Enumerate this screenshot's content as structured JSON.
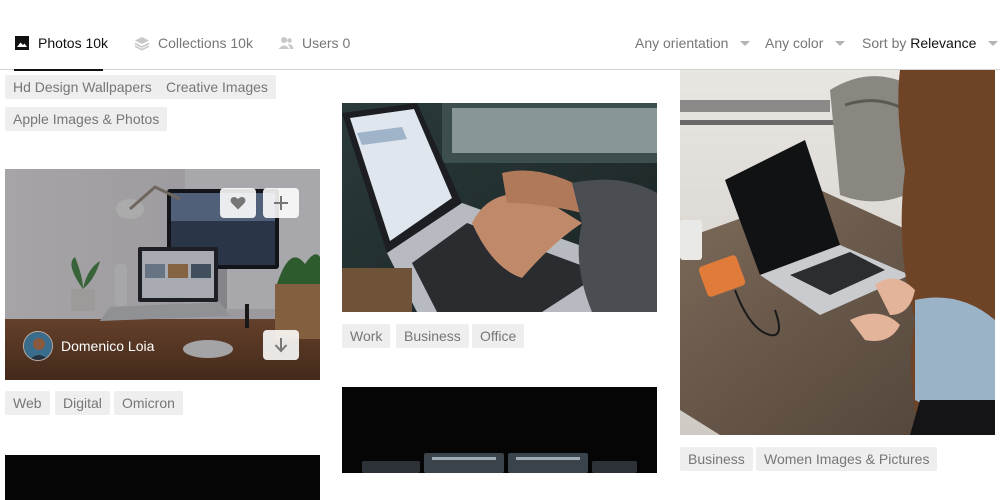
{
  "tabs": [
    {
      "label": "Photos",
      "count": "10k",
      "icon": "image-icon",
      "active": true
    },
    {
      "label": "Collections",
      "count": "10k",
      "icon": "layers-icon",
      "active": false
    },
    {
      "label": "Users",
      "count": "0",
      "icon": "users-icon",
      "active": false
    }
  ],
  "filters": {
    "orientation": "Any orientation",
    "color": "Any color",
    "sort_prefix": "Sort by",
    "sort_value": "Relevance"
  },
  "related_tags": [
    "Hd Design Wallpapers",
    "Creative Images",
    "Apple Images & Photos"
  ],
  "photos": [
    {
      "tags": [
        "Web",
        "Digital",
        "Omicron"
      ],
      "author": "Domenico Loia",
      "hovered": true
    },
    {
      "tags": [
        "Work",
        "Business",
        "Office"
      ]
    },
    {
      "tags": [
        "Business",
        "Women Images & Pictures"
      ]
    }
  ],
  "colors": {
    "active_text": "#111111",
    "muted_text": "#767676",
    "tag_bg": "#eeeeee",
    "border": "#d1d1d1"
  }
}
